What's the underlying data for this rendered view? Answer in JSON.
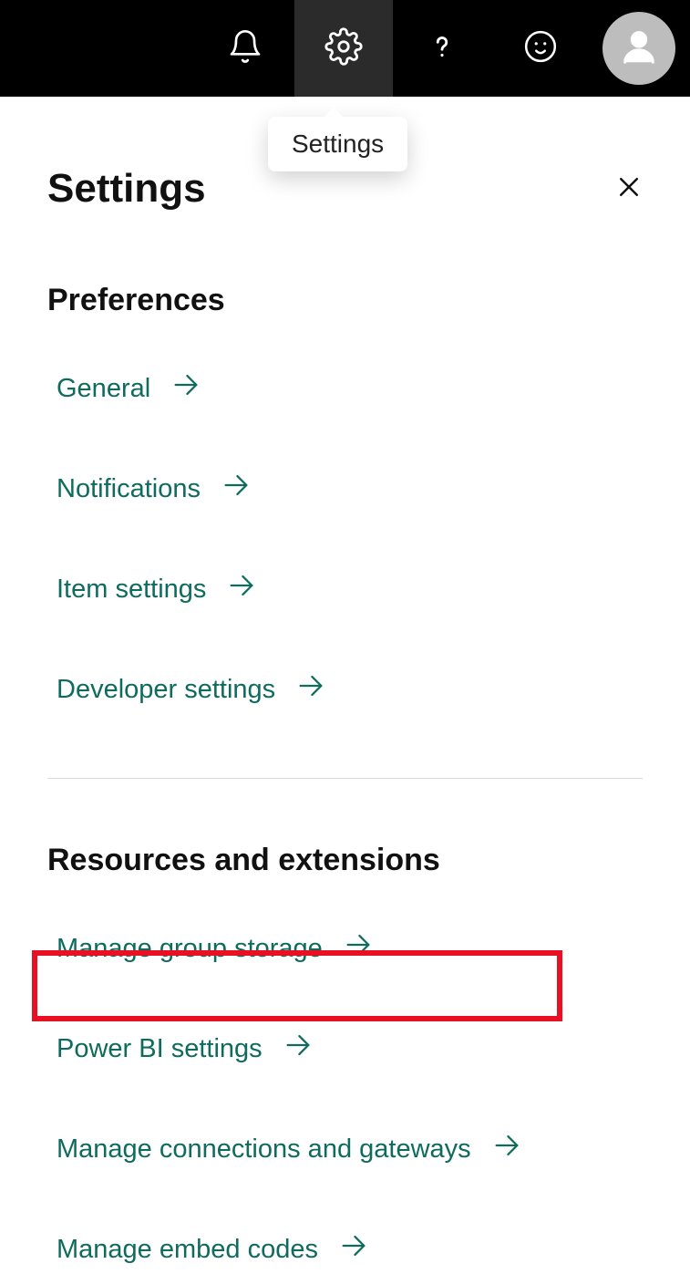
{
  "tooltip": {
    "label": "Settings"
  },
  "panel": {
    "title": "Settings",
    "sections": {
      "prefs": {
        "title": "Preferences",
        "items": [
          "General",
          "Notifications",
          "Item settings",
          "Developer settings"
        ]
      },
      "resources": {
        "title": "Resources and extensions",
        "items": [
          "Manage group storage",
          "Power BI settings",
          "Manage connections and gateways",
          "Manage embed codes"
        ]
      }
    }
  }
}
